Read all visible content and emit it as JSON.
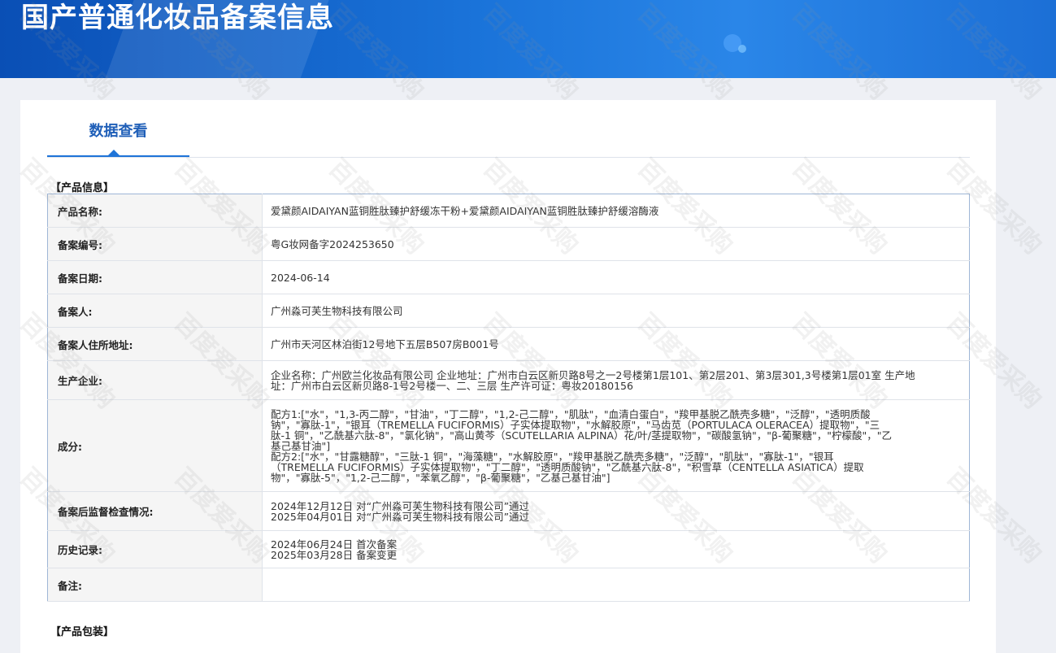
{
  "page_title": "国产普通化妆品备案信息",
  "tab": {
    "label": "数据查看"
  },
  "section_product_info": "【产品信息】",
  "section_packaging": "【产品包装】",
  "watermark": "百度爱采购",
  "rows": [
    {
      "label": "产品名称:",
      "lines": [
        "爱黛颜AIDAIYAN蓝铜胜肽臻护舒缓冻干粉+爱黛颜AIDAIYAN蓝铜胜肽臻护舒缓溶酶液"
      ]
    },
    {
      "label": "备案编号:",
      "lines": [
        "粤G妆网备字2024253650"
      ]
    },
    {
      "label": "备案日期:",
      "lines": [
        "2024-06-14"
      ]
    },
    {
      "label": "备案人:",
      "lines": [
        "广州淼可芙生物科技有限公司"
      ]
    },
    {
      "label": "备案人住所地址:",
      "lines": [
        "广州市天河区林泊街12号地下五层B507房B001号"
      ]
    },
    {
      "label": "生产企业:",
      "lines": [
        "企业名称：广州欧兰化妆品有限公司 企业地址：广州市白云区新贝路8号之一2号楼第1层101、第2层201、第3层301,3号楼第1层01室 生产地",
        "址：广州市白云区新贝路8-1号2号楼一、二、三层 生产许可证：粤妆20180156"
      ]
    },
    {
      "label": "成分:",
      "lines": [
        "配方1:[\"水\"，\"1,3-丙二醇\"，\"甘油\"，\"丁二醇\"，\"1,2-己二醇\"，\"肌肽\"，\"血清白蛋白\"，\"羧甲基脱乙酰壳多糖\"，\"泛醇\"，\"透明质酸",
        "钠\"，\"寡肽-1\"，\"银耳（TREMELLA FUCIFORMIS）子实体提取物\"，\"水解胶原\"，\"马齿苋（PORTULACA OLERACEA）提取物\"，\"三",
        "肽-1 铜\"，\"乙酰基六肽-8\"，\"氯化钠\"，\"高山黄芩（SCUTELLARIA ALPINA）花/叶/茎提取物\"，\"碳酸氢钠\"，\"β-葡聚糖\"，\"柠檬酸\"，\"乙",
        "基己基甘油\"]",
        "配方2:[\"水\"，\"甘露糖醇\"，\"三肽-1 铜\"，\"海藻糖\"，\"水解胶原\"，\"羧甲基脱乙酰壳多糖\"，\"泛醇\"，\"肌肽\"，\"寡肽-1\"，\"银耳",
        "（TREMELLA FUCIFORMIS）子实体提取物\"，\"丁二醇\"，\"透明质酸钠\"，\"乙酰基六肽-8\"，\"积雪草（CENTELLA ASIATICA）提取",
        "物\"，\"寡肽-5\"，\"1,2-己二醇\"，\"苯氧乙醇\"，\"β-葡聚糖\"，\"乙基己基甘油\"]"
      ]
    },
    {
      "label": "备案后监督检查情况:",
      "lines": [
        "2024年12月12日 对“广州淼可芙生物科技有限公司”通过",
        "2025年04月01日 对“广州淼可芙生物科技有限公司”通过"
      ]
    },
    {
      "label": "历史记录:",
      "lines": [
        "2024年06月24日 首次备案",
        "2025年03月28日 备案变更"
      ]
    },
    {
      "label": "备注:",
      "lines": []
    }
  ]
}
